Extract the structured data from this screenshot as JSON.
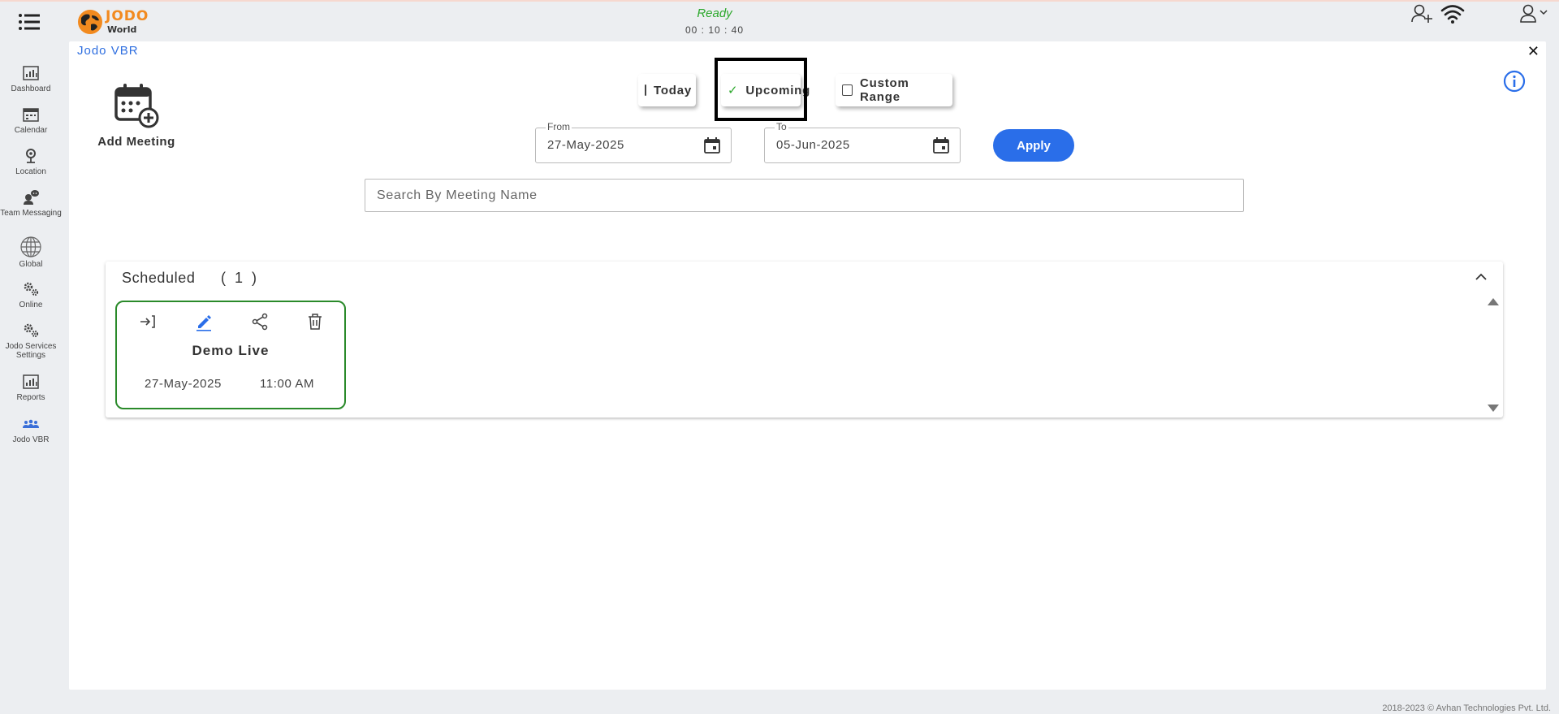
{
  "app": {
    "logo_title": "JODO",
    "logo_subtitle": "World",
    "status": "Ready",
    "timer": "00 : 10 : 40"
  },
  "sidebar": {
    "items": [
      {
        "label": "Dashboard",
        "icon": "dashboard-icon"
      },
      {
        "label": "Calendar",
        "icon": "calendar-icon"
      },
      {
        "label": "Location",
        "icon": "location-icon"
      },
      {
        "label": "Team Messaging",
        "icon": "team-messaging-icon"
      },
      {
        "label": "Global",
        "icon": "globe-icon"
      },
      {
        "label": "Online",
        "icon": "gears-icon"
      },
      {
        "label": "Jodo Services Settings",
        "icon": "gears-icon"
      },
      {
        "label": "Reports",
        "icon": "reports-icon"
      },
      {
        "label": "Jodo VBR",
        "icon": "group-icon"
      }
    ]
  },
  "panel": {
    "title": "Jodo VBR",
    "add_meeting_label": "Add Meeting"
  },
  "filters": {
    "today": "Today",
    "upcoming": "Upcoming",
    "custom_range": "Custom Range",
    "selected": "Upcoming"
  },
  "dates": {
    "from_label": "From",
    "from_value": "27-May-2025",
    "to_label": "To",
    "to_value": "05-Jun-2025",
    "apply_label": "Apply"
  },
  "search": {
    "placeholder": "Search By Meeting Name"
  },
  "scheduled": {
    "title": "Scheduled",
    "count": "( 1 )",
    "meetings": [
      {
        "name": "Demo Live",
        "date": "27-May-2025",
        "time": "11:00 AM"
      }
    ]
  },
  "footer": {
    "copyright": "2018-2023 © Avhan Technologies Pvt. Ltd."
  },
  "colors": {
    "accent": "#2a6ee9",
    "status_ready": "#2ca82c",
    "logo_orange": "#f28a1f",
    "card_border": "#2a8a2a"
  }
}
